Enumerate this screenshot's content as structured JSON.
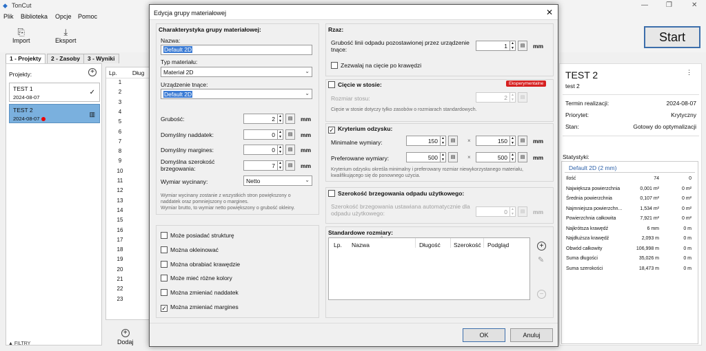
{
  "app": {
    "title": "TonCut"
  },
  "menu": [
    "Plik",
    "Biblioteka",
    "Opcje",
    "Pomoc"
  ],
  "toolbar": {
    "import": "Import",
    "export": "Eksport"
  },
  "tabs": [
    "1 - Projekty",
    "2 - Zasoby",
    "3 - Wyniki"
  ],
  "projects": {
    "label": "Projekty:",
    "items": [
      {
        "name": "TEST 1",
        "date": "2024-08-07"
      },
      {
        "name": "TEST 2",
        "date": "2024-08-07"
      }
    ]
  },
  "list": {
    "col_lp": "Lp.",
    "col_len": "Dług",
    "rows": [
      "1",
      "2",
      "3",
      "4",
      "5",
      "6",
      "7",
      "8",
      "9",
      "10",
      "11",
      "12",
      "13",
      "14",
      "15",
      "16",
      "17",
      "18",
      "19",
      "20",
      "21",
      "22",
      "23"
    ]
  },
  "filters": "FILTRY",
  "add": "Dodaj",
  "start": "Start",
  "detail": {
    "title": "TEST 2",
    "subtitle": "test 2",
    "fields": [
      {
        "k": "Termin realizacji:",
        "v": "2024-08-07"
      },
      {
        "k": "Priorytet:",
        "v": "Krytyczny"
      },
      {
        "k": "Stan:",
        "v": "Gotowy do optymalizacji"
      }
    ],
    "stats_label": "Statystyki:",
    "stats_group": "Default 2D (2 mm)",
    "stats": [
      {
        "k": "Ilość",
        "a": "74",
        "b": "0"
      },
      {
        "k": "Największa powierzchnia",
        "a": "0,001 m²",
        "b": "0 m²"
      },
      {
        "k": "Średnia powierzchnia",
        "a": "0,107 m²",
        "b": "0 m²"
      },
      {
        "k": "Najmniejsza powierzchn...",
        "a": "1,534 m²",
        "b": "0 m²"
      },
      {
        "k": "Powierzchnia całkowita",
        "a": "7,921 m²",
        "b": "0 m²"
      },
      {
        "k": "Najkrótsza krawędź",
        "a": "6 mm",
        "b": "0 m"
      },
      {
        "k": "Najdłuższa krawędź",
        "a": "2,093 m",
        "b": "0 m"
      },
      {
        "k": "Obwód całkowity",
        "a": "106,998 m",
        "b": "0 m"
      },
      {
        "k": "Suma długości",
        "a": "35,026 m",
        "b": "0 m"
      },
      {
        "k": "Suma szerokości",
        "a": "18,473 m",
        "b": "0 m"
      }
    ]
  },
  "dialog": {
    "title": "Edycja grupy materiałowej",
    "close": "✕",
    "left": {
      "section": "Charakterystyka grupy materiałowej:",
      "name_label": "Nazwa:",
      "name_value": "Default 2D",
      "type_label": "Typ materiału:",
      "type_value": "Materiał 2D",
      "tool_label": "Urządzenie tnące:",
      "tool_value": "Default 2D",
      "thickness_label": "Grubość:",
      "thickness_value": "2",
      "allowance_label": "Domyślny naddatek:",
      "allowance_value": "0",
      "margins_label": "Domyślny margines:",
      "margins_value": "0",
      "edge_label_1": "Domyślna szerokość",
      "edge_label_2": "brzegowania:",
      "edge_value": "7",
      "unit": "mm",
      "dim_label": "Wymiar wycinany:",
      "dim_value": "Netto",
      "help_1": "Wymiar wycinany zostanie z wszystkich stron powiększony o",
      "help_2": "naddatek oraz pomniejszony o margines.",
      "help_3": "Wymiar brutto, to wymiar netto powiększony o grubość okleiny.",
      "checks": [
        {
          "label": "Może posiadać strukturę",
          "checked": false
        },
        {
          "label": "Można okleinować",
          "checked": false
        },
        {
          "label": "Można obrabiać krawędzie",
          "checked": false
        },
        {
          "label": "Może mieć różne kolory",
          "checked": false
        },
        {
          "label": "Można zmieniać naddatek",
          "checked": false
        },
        {
          "label": "Można zmieniać margines",
          "checked": true
        }
      ]
    },
    "right": {
      "cut_section": "Rzaz:",
      "cut_label_1": "Grubość linii odpadu pozostawionej przez urządzenie",
      "cut_label_2": "tnące:",
      "cut_value": "1",
      "unit": "mm",
      "edge_cut": "Zezwalaj na cięcie po krawędzi",
      "stack_title": "Cięcie w stosie:",
      "stack_badge": "Eksperymentalne",
      "stack_size_label": "Rozmiar stosu:",
      "stack_size_value": "2",
      "stack_help": "Cięcie w stosie dotyczy tylko zasobów o rozmiarach standardowych.",
      "recovery_title": "Kryterium odzysku:",
      "min_label": "Minimalne wymiary:",
      "min_w": "150",
      "min_h": "150",
      "pref_label": "Preferowane wymiary:",
      "pref_w": "500",
      "pref_h": "500",
      "times": "×",
      "recovery_help_1": "Kryterium odzysku określa minimalny i preferowany rozmiar niewykorzystanego materiału,",
      "recovery_help_2": "kwalifikującego się do ponownego użycia.",
      "edgewaste_title": "Szerokość brzegowania odpadu użytkowego:",
      "edgewaste_label_1": "Szerokość brzegowania ustawiana automatycznie dla",
      "edgewaste_label_2": "odpadu użytkowego:",
      "edgewaste_value": "0",
      "std_title": "Standardowe rozmiary:",
      "std_cols": [
        "Lp.",
        "Nazwa",
        "Długość",
        "Szerokość",
        "Podgląd"
      ]
    },
    "ok": "OK",
    "cancel": "Anuluj"
  }
}
